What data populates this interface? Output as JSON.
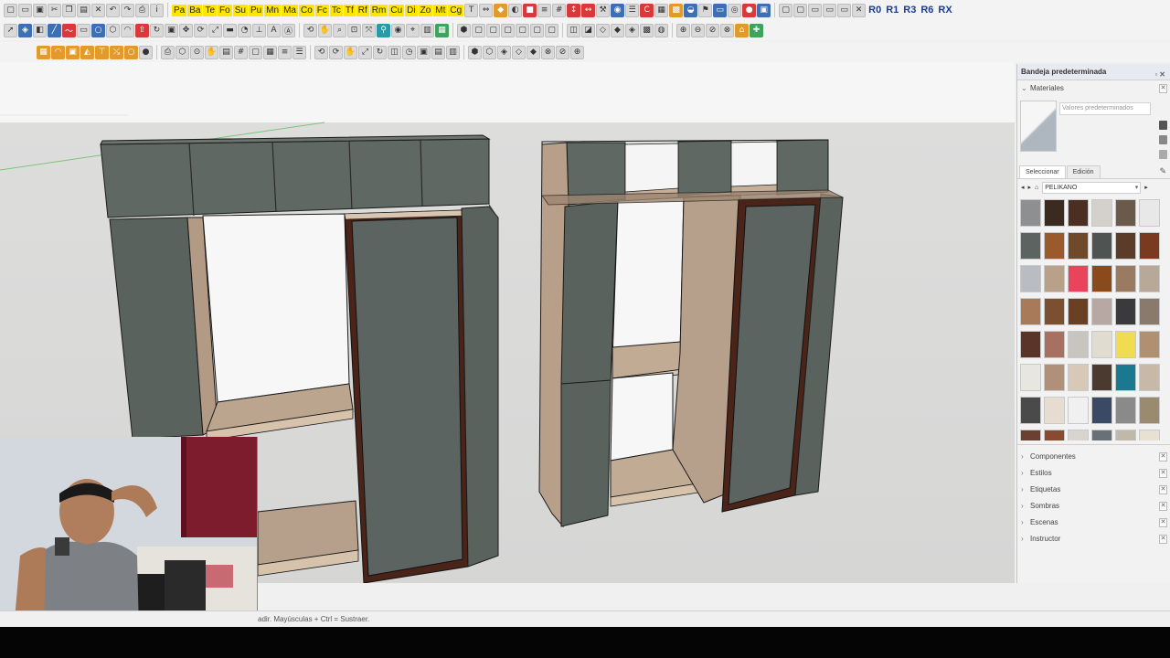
{
  "toolbar": {
    "row1_labels": [
      "Pa",
      "Ba",
      "Te",
      "Fo",
      "Su",
      "Pu",
      "Mn",
      "Ma",
      "Co",
      "Fc",
      "Tc",
      "Tf",
      "Rf",
      "Rm",
      "Cu",
      "Di",
      "Zo",
      "Mt",
      "Cg"
    ],
    "right_labels": [
      "R0",
      "R1",
      "R3",
      "R6",
      "RX"
    ]
  },
  "status_bar": {
    "hint": "adir. Mayúsculas + Ctrl = Sustraer."
  },
  "tray": {
    "title": "Bandeja predeterminada",
    "materials_section": "Materiales",
    "material_name_placeholder": "Valores predeterminados",
    "tab_select": "Seleccionar",
    "tab_edit": "Edición",
    "library": "PELIKANO",
    "swatch_colors": [
      "#8d8f91",
      "#3a2a20",
      "#4a2f22",
      "#d4d0cc",
      "#6a5a4a",
      "#e8e8e8",
      "#5d6360",
      "#9a5a2c",
      "#6e4a2a",
      "#4f5352",
      "#5b3b2a",
      "#7a3a20",
      "#b9bcc0",
      "#b8a089",
      "#e8445c",
      "#8a4a1c",
      "#9a7a60",
      "#b8a898",
      "#a87a5a",
      "#7a5030",
      "#6a4024",
      "#b8a8a4",
      "#3a3a3c",
      "#8a7a6c",
      "#5a3428",
      "#a87060",
      "#c8c4c0",
      "#e0dcd0",
      "#f0dc50",
      "#b09070",
      "#e8e6e0",
      "#b09078",
      "#d8c8b8",
      "#4a3a30",
      "#1a7890",
      "#c8b8a8",
      "#4a4a4a",
      "#e6ddd0",
      "#f0f0f0",
      "#3a4a64",
      "#8a8a8a",
      "#9a8a70",
      "#6a4030",
      "#8a4a30",
      "#d8d4d0",
      "#6a7078",
      "#c0b8a8",
      "#e8e0d0"
    ],
    "sections": [
      "Componentes",
      "Estilos",
      "Etiquetas",
      "Sombras",
      "Escenas",
      "Instructor"
    ]
  },
  "colors": {
    "panel_green": "#5d6661",
    "wood": "#b7a08d",
    "frame": "#4a2418"
  }
}
